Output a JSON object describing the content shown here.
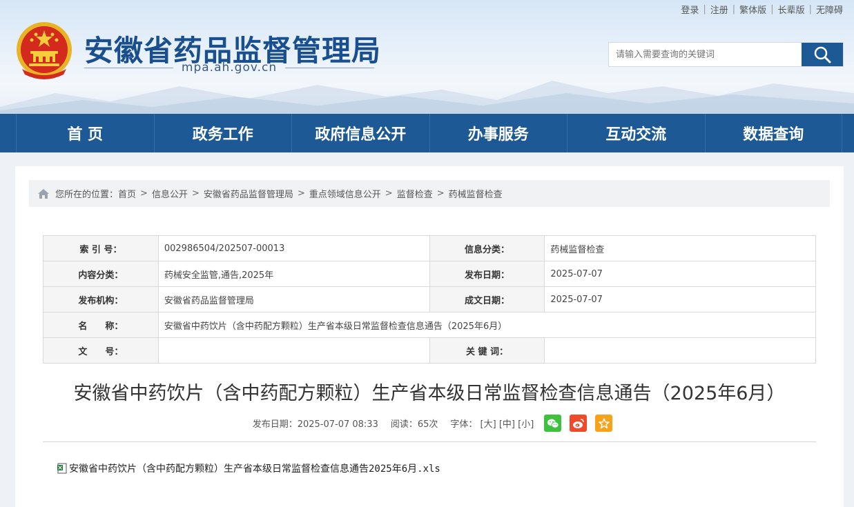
{
  "top_links": [
    "登录",
    "注册",
    "繁体版",
    "长辈版",
    "无障碍"
  ],
  "site": {
    "title": "安徽省药品监督管理局",
    "domain": "mpa.ah.gov.cn"
  },
  "search": {
    "placeholder": "请输入需要查询的关键词"
  },
  "nav": [
    "首 页",
    "政务工作",
    "政府信息公开",
    "办事服务",
    "互动交流",
    "数据查询"
  ],
  "breadcrumb": {
    "prefix": "您所在的位置：",
    "items": [
      "首页",
      "信息公开",
      "安徽省药品监督管理局",
      "重点领域信息公开",
      "监督检查",
      "药械监督检查"
    ],
    "separator": ">"
  },
  "meta": {
    "index_label": "索 引 号：",
    "index_value": "002986504/202507-00013",
    "category_label": "信息分类：",
    "category_value": "药械监督检查",
    "content_type_label": "内容分类：",
    "content_type_value": "药械安全监管,通告,2025年",
    "publish_date_label": "发布日期：",
    "publish_date_value": "2025-07-07",
    "publisher_label": "发布机构：",
    "publisher_value": "安徽省药品监督管理局",
    "created_date_label": "成文日期：",
    "created_date_value": "2025-07-07",
    "name_label": "名　　称：",
    "name_value": "安徽省中药饮片（含中药配方颗粒）生产省本级日常监督检查信息通告（2025年6月）",
    "doc_no_label": "文　　号：",
    "doc_no_value": "",
    "keywords_label": "关 键 词：",
    "keywords_value": ""
  },
  "article": {
    "title": "安徽省中药饮片（含中药配方颗粒）生产省本级日常监督检查信息通告（2025年6月）",
    "publish_info": "发布日期：2025-07-07 08:33",
    "views": "阅读：65次",
    "font_label": "字体：",
    "font_large": "[大]",
    "font_medium": "[中]",
    "font_small": "[小]"
  },
  "attachment": {
    "filename": "安徽省中药饮片（含中药配方颗粒）生产省本级日常监督检查信息通告2025年6月.xls"
  },
  "colors": {
    "brand_blue": "#1d5a95",
    "title_blue": "#1a4f8f",
    "wechat": "#3ec13d",
    "weibo": "#f04a2a",
    "favorite": "#f7a21b"
  }
}
